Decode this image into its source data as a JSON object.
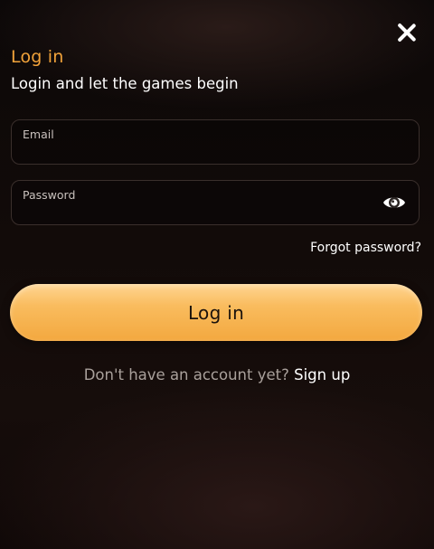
{
  "dialog": {
    "title": "Log in",
    "subtitle": "Login and let the games begin",
    "close_icon": "close-icon"
  },
  "form": {
    "email": {
      "label": "Email",
      "value": "",
      "placeholder": ""
    },
    "password": {
      "label": "Password",
      "value": "",
      "placeholder": "",
      "toggle_icon": "eye-icon"
    },
    "forgot_password": "Forgot password?",
    "submit_label": "Log in"
  },
  "signup": {
    "prompt": "Don't have an account yet?",
    "link": "Sign up"
  },
  "colors": {
    "accent": "#f2a33a",
    "button_top": "#ffd592",
    "button_bottom": "#f3a83f",
    "background": "#120b09",
    "muted_text": "#a9a09b"
  }
}
